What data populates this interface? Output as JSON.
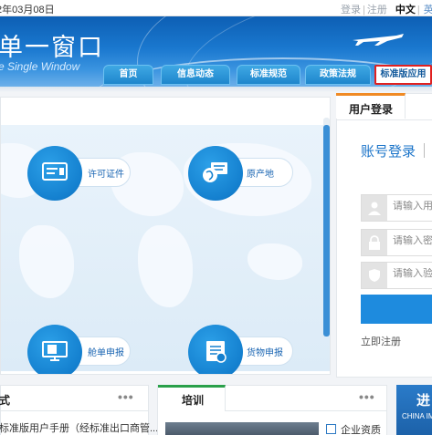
{
  "topbar": {
    "date": "2年03月08日",
    "login": "登录",
    "register": "注册",
    "lang_cn": "中文",
    "lang_en": "英文"
  },
  "banner": {
    "title_cn": "单一窗口",
    "title_en": "e Single Window"
  },
  "nav": {
    "tabs": [
      "首页",
      "信息动态",
      "标准规范",
      "政策法规",
      "标准版应用"
    ],
    "active_tab": "标准版应用"
  },
  "services": {
    "items": [
      {
        "label": "许可证件",
        "icon": "license-icon"
      },
      {
        "label": "原产地",
        "icon": "origin-icon"
      },
      {
        "label": "舱单申报",
        "icon": "manifest-icon"
      },
      {
        "label": "货物申报",
        "icon": "cargo-declaration-icon"
      }
    ]
  },
  "login": {
    "tab": "用户登录",
    "headline": "账号登录",
    "username_placeholder": "请输入用",
    "password_placeholder": "请输入密",
    "captcha_placeholder": "请输入验",
    "register_now": "立即注册"
  },
  "panels": {
    "left": {
      "title": "式",
      "more": "•••",
      "item": "标准版用户手册（经标准出口商管..."
    },
    "middle": {
      "title": "培训",
      "more": "•••",
      "link": "企业资质"
    },
    "right": {
      "big": "进",
      "small": "CHINA IM"
    }
  },
  "colors": {
    "brand_blue": "#1b74c9",
    "tab_blue": "#1e86cc",
    "active_border": "#e02020",
    "login_accent": "#f08a24",
    "train_accent": "#2aa04a"
  }
}
